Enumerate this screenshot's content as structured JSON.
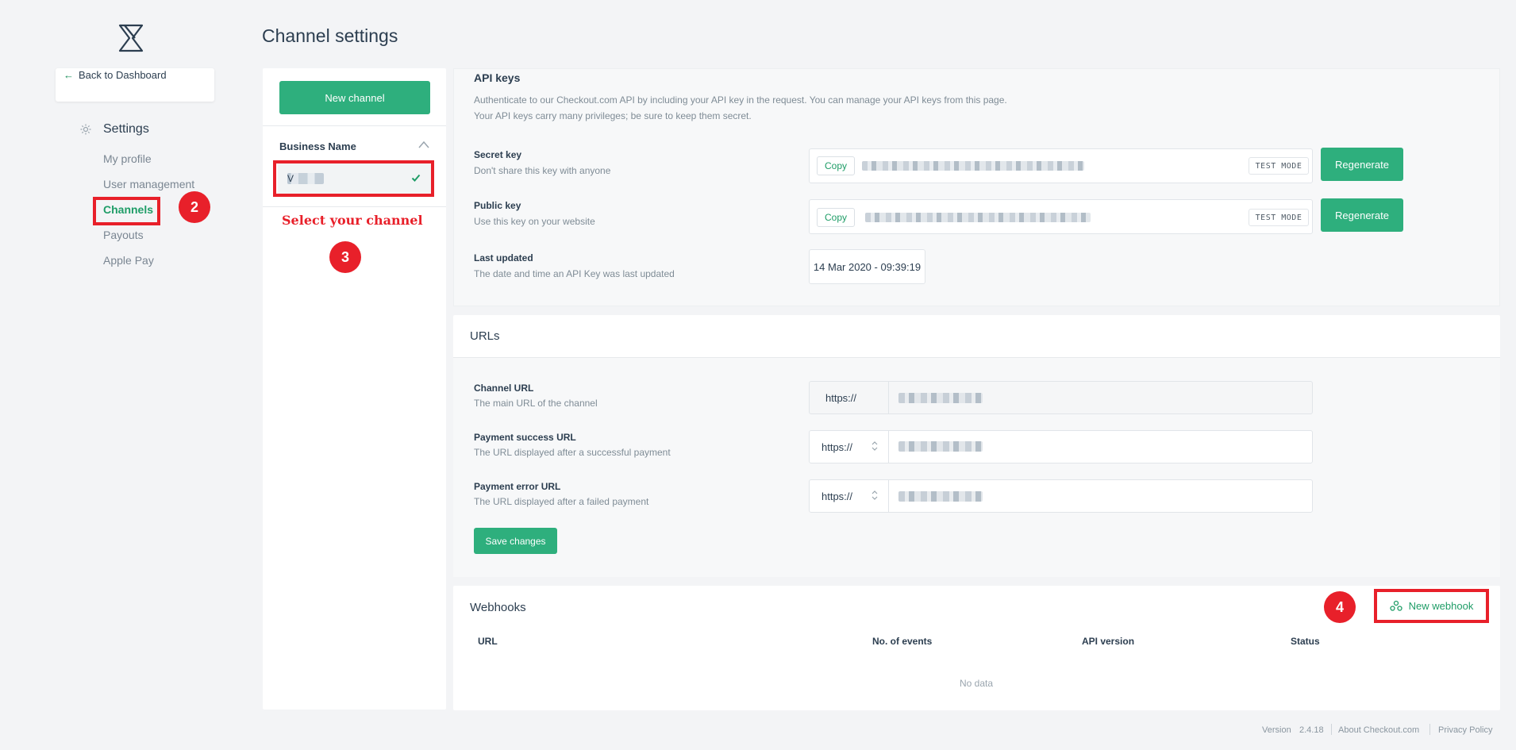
{
  "page": {
    "title": "Channel settings"
  },
  "sidebar": {
    "back_label": "Back to Dashboard",
    "section_title": "Settings",
    "items": [
      {
        "label": "My profile"
      },
      {
        "label": "User management"
      },
      {
        "label": "Channels",
        "active": true
      },
      {
        "label": "Payouts"
      },
      {
        "label": "Apple Pay"
      }
    ]
  },
  "annotations": {
    "step2": "2",
    "step3": "3",
    "step4": "4",
    "select_channel": "Select your channel",
    "color": "#e8202a"
  },
  "channels": {
    "new_channel_label": "New channel",
    "group_name": "Business Name",
    "selected_channel_initial": "V"
  },
  "api_keys": {
    "title": "API keys",
    "description_line1": "Authenticate to our Checkout.com API by including your API key in the request. You can manage your API keys from this page.",
    "description_line2": "Your API keys carry many privileges; be sure to keep them secret.",
    "secret_key": {
      "label": "Secret key",
      "hint": "Don't share this key with anyone",
      "copy_label": "Copy",
      "mode_badge": "TEST MODE",
      "regen_label": "Regenerate"
    },
    "public_key": {
      "label": "Public key",
      "hint": "Use this key on your website",
      "copy_label": "Copy",
      "mode_badge": "TEST MODE",
      "regen_label": "Regenerate"
    },
    "last_updated": {
      "label": "Last updated",
      "hint": "The date and time an API Key was last updated",
      "value": "14 Mar 2020 - 09:39:19"
    }
  },
  "urls": {
    "title": "URLs",
    "channel_url": {
      "label": "Channel URL",
      "hint": "The main URL of the channel",
      "protocol": "https://"
    },
    "success_url": {
      "label": "Payment success URL",
      "hint": "The URL displayed after a successful payment",
      "protocol": "https://"
    },
    "error_url": {
      "label": "Payment error URL",
      "hint": "The URL displayed after a failed payment",
      "protocol": "https://"
    },
    "save_label": "Save changes"
  },
  "webhooks": {
    "title": "Webhooks",
    "new_label": "New webhook",
    "columns": [
      "URL",
      "No. of events",
      "API version",
      "Status"
    ],
    "empty_text": "No data"
  },
  "footer": {
    "version_label": "Version",
    "version": "2.4.18",
    "about": "About Checkout.com",
    "privacy": "Privacy Policy"
  },
  "colors": {
    "accent": "#2eaf7d",
    "accent_text": "#1f9d67",
    "background": "#f3f4f6"
  }
}
